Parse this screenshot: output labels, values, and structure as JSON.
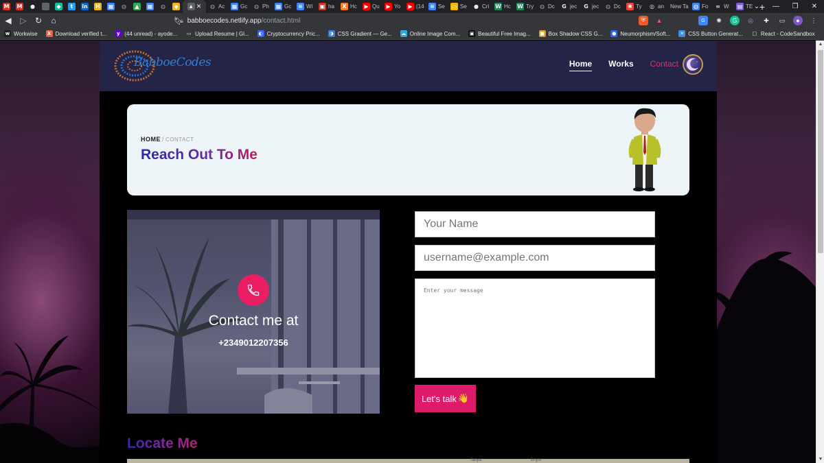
{
  "browser": {
    "active_tab_label": "",
    "tabs": [
      {
        "icon": "gmail-icon",
        "color": "#d93025",
        "glyph": "M"
      },
      {
        "icon": "gmail-icon",
        "color": "#d93025",
        "glyph": "M"
      },
      {
        "icon": "github-icon",
        "color": "#e8eaed",
        "glyph": "●"
      },
      {
        "icon": "blank-icon",
        "color": "#5f6368",
        "glyph": ""
      },
      {
        "icon": "diamond-icon",
        "color": "#1abc9c",
        "glyph": "◆"
      },
      {
        "icon": "twitter-icon",
        "color": "#1da1f2",
        "glyph": "t"
      },
      {
        "icon": "linkedin-icon",
        "color": "#0a66c2",
        "glyph": "in"
      },
      {
        "icon": "hashnode-icon",
        "color": "#f2b705",
        "glyph": "H"
      },
      {
        "icon": "calendar-icon",
        "color": "#4285f4",
        "glyph": "▦"
      },
      {
        "icon": "globe-icon",
        "color": "#9aa0a6",
        "glyph": "◍"
      },
      {
        "icon": "drive-icon",
        "color": "#34a853",
        "glyph": "▲"
      },
      {
        "icon": "calendar-icon",
        "color": "#4285f4",
        "glyph": "▦"
      },
      {
        "icon": "globe-icon",
        "color": "#9aa0a6",
        "glyph": "◍"
      },
      {
        "icon": "binance-icon",
        "color": "#f0b90b",
        "glyph": "◆"
      }
    ],
    "tabs_after": [
      {
        "label": "Ac",
        "icon": "globe-icon",
        "color": "#9aa0a6",
        "glyph": "◍"
      },
      {
        "label": "Gc",
        "icon": "google-icon",
        "color": "#4285f4",
        "glyph": "▦"
      },
      {
        "label": "Ph",
        "icon": "globe-icon",
        "color": "#9aa0a6",
        "glyph": "◍"
      },
      {
        "label": "Gc",
        "icon": "google-icon",
        "color": "#4285f4",
        "glyph": "▦"
      },
      {
        "label": "Wi",
        "icon": "docs-icon",
        "color": "#4285f4",
        "glyph": "≡"
      },
      {
        "label": "ha",
        "icon": "flag-icon",
        "color": "#c0392b",
        "glyph": "▣"
      },
      {
        "label": "Hc",
        "icon": "xampp-icon",
        "color": "#fb7a24",
        "glyph": "X"
      },
      {
        "label": "Qu",
        "icon": "youtube-icon",
        "color": "#ff0000",
        "glyph": "▶"
      },
      {
        "label": "Yo",
        "icon": "youtube-icon",
        "color": "#ff0000",
        "glyph": "▶"
      },
      {
        "label": "(14",
        "icon": "youtube-icon",
        "color": "#ff0000",
        "glyph": "▶"
      },
      {
        "label": "Se",
        "icon": "docs-icon",
        "color": "#4285f4",
        "glyph": "≡"
      },
      {
        "label": "Se",
        "icon": "slides-icon",
        "color": "#f4b400",
        "glyph": "▭"
      },
      {
        "label": "Cri",
        "icon": "github-icon",
        "color": "#e8eaed",
        "glyph": "●"
      },
      {
        "label": "Hc",
        "icon": "w-icon",
        "color": "#1b8a5a",
        "glyph": "W"
      },
      {
        "label": "Try",
        "icon": "w-icon",
        "color": "#1b8a5a",
        "glyph": "W"
      },
      {
        "label": "Dc",
        "icon": "globe-icon",
        "color": "#9aa0a6",
        "glyph": "◍"
      },
      {
        "label": "jec",
        "icon": "google-icon",
        "color": "#e8eaed",
        "glyph": "G"
      },
      {
        "label": "jec",
        "icon": "google-icon",
        "color": "#e8eaed",
        "glyph": "G"
      },
      {
        "label": "Dc",
        "icon": "globe-icon",
        "color": "#9aa0a6",
        "glyph": "◍"
      },
      {
        "label": "Ty",
        "icon": "asterisk-icon",
        "color": "#e8453c",
        "glyph": "✱"
      },
      {
        "label": "an",
        "icon": "globe-icon",
        "color": "#e8eaed",
        "glyph": "◎"
      },
      {
        "label": "New Ta",
        "icon": "",
        "color": "",
        "glyph": ""
      },
      {
        "label": "Fo",
        "icon": "globe-icon",
        "color": "#4285f4",
        "glyph": "◍"
      },
      {
        "label": "W",
        "icon": "infinity-icon",
        "color": "#e8eaed",
        "glyph": "∞"
      },
      {
        "label": "TE",
        "icon": "box-icon",
        "color": "#7b5cd6",
        "glyph": "▤"
      }
    ],
    "url_host": "babboecodes.netlify.app",
    "url_path": "/contact.html",
    "bookmarks": [
      {
        "label": "Workwise",
        "icon": "workwise-icon",
        "color": "#222",
        "glyph": "w"
      },
      {
        "label": "Download verified t...",
        "icon": "x-icon",
        "color": "#e8603c",
        "glyph": "X"
      },
      {
        "label": "(44 unread) - ayode...",
        "icon": "yahoo-icon",
        "color": "#6001d2",
        "glyph": "y"
      },
      {
        "label": "Upload Resume | Gl...",
        "icon": "glassdoor-icon",
        "color": "#e8eaed",
        "glyph": "▭"
      },
      {
        "label": "Cryptocurrency Pric...",
        "icon": "coinmarketcap-icon",
        "color": "#3861fb",
        "glyph": "◐"
      },
      {
        "label": "CSS Gradient — Ge...",
        "icon": "gradient-icon",
        "color": "#3a7bd5",
        "glyph": "◑"
      },
      {
        "label": "Online Image Com...",
        "icon": "cloud-icon",
        "color": "#29abe2",
        "glyph": "☁"
      },
      {
        "label": "Beautiful Free Imag...",
        "icon": "unsplash-icon",
        "color": "#111",
        "glyph": "▣"
      },
      {
        "label": "Box Shadow CSS G...",
        "icon": "box-icon",
        "color": "#d29b2b",
        "glyph": "■"
      },
      {
        "label": "Neumorphism/Soft...",
        "icon": "neumorphism-icon",
        "color": "#2f64f5",
        "glyph": "●"
      },
      {
        "label": "CSS Button Generat...",
        "icon": "tools-icon",
        "color": "#3b8fe0",
        "glyph": "✕"
      },
      {
        "label": "React - CodeSandbox",
        "icon": "codesandbox-icon",
        "color": "#e8eaed",
        "glyph": "□"
      }
    ]
  },
  "site": {
    "logo_text": "BabboeCodes",
    "nav": {
      "home": "Home",
      "works": "Works",
      "contact": "Contact"
    },
    "hero": {
      "crumb_home": "HOME",
      "crumb_sep": "/",
      "crumb_current": "CONTACT",
      "title": "Reach Out To Me"
    },
    "contact_card": {
      "heading": "Contact me at",
      "phone": "+2349012207356"
    },
    "form": {
      "name_placeholder": "Your Name",
      "email_placeholder": "username@example.com",
      "message_placeholder": "Enter your message",
      "submit_label": "Let's talk",
      "submit_emoji": "👋"
    },
    "locate_title": "Locate Me",
    "map_labels": [
      "Tahya",
      "Enym"
    ]
  },
  "colors": {
    "header_bg": "#242447",
    "accent_pink": "#e01a6a",
    "hero_card_bg": "#edf4f8"
  }
}
